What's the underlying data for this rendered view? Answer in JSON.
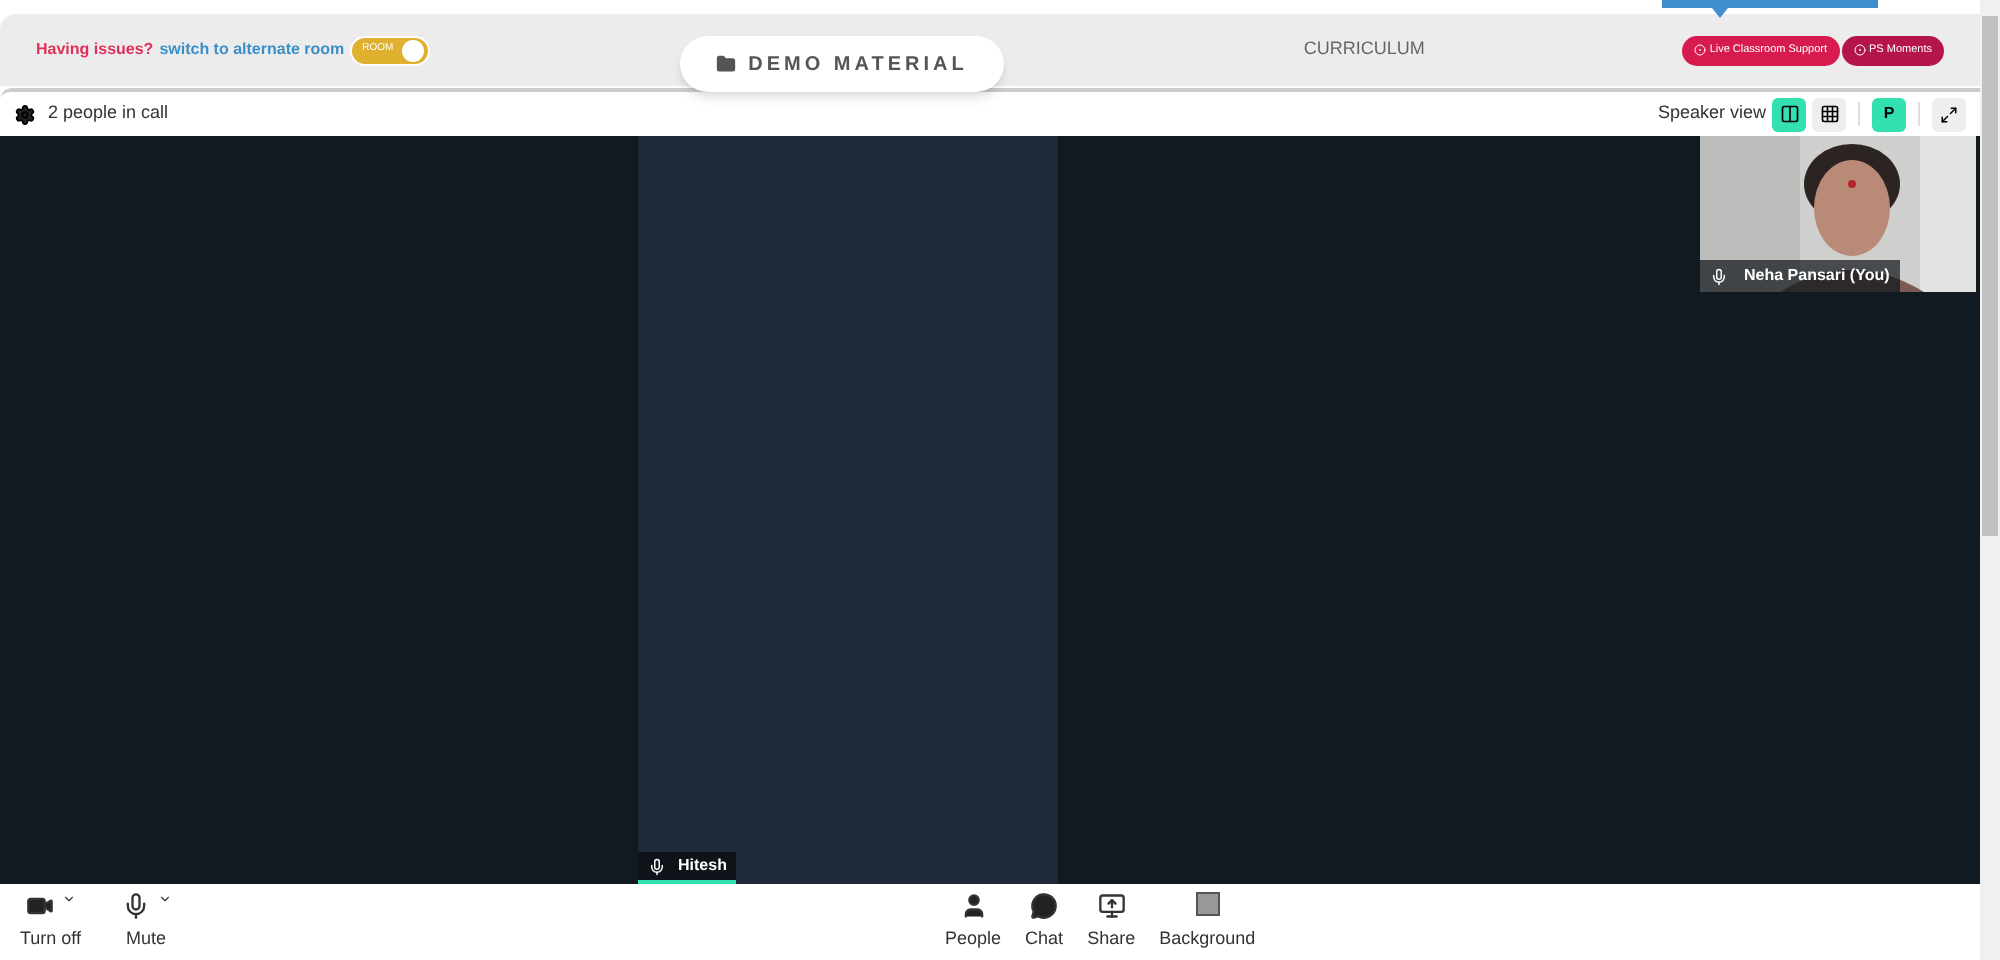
{
  "header": {
    "issue_text": "Having issues?",
    "switch_link": "switch to alternate room",
    "room_toggle": {
      "label": "ROOM",
      "on": true
    },
    "demo_button": "DEMO MATERIAL",
    "curriculum": "CURRICULUM",
    "support_buttons": [
      "Live Classroom Support",
      "PS Moments"
    ]
  },
  "call_bar": {
    "people_count": "2 people in call",
    "view_label": "Speaker view",
    "views": [
      {
        "kind": "speaker",
        "selected": true
      },
      {
        "kind": "grid",
        "selected": false
      }
    ],
    "avatar_letter": "P"
  },
  "participants": [
    {
      "name": "Hitesh",
      "kind": "tile"
    },
    {
      "name": "Neha Pansari (You)",
      "kind": "self"
    }
  ],
  "controls": [
    {
      "label": "Turn off",
      "kind": "camera",
      "dropdown": true
    },
    {
      "label": "Mute",
      "kind": "mic",
      "dropdown": true
    },
    {
      "label": "People",
      "kind": "people",
      "dropdown": false
    },
    {
      "label": "Chat",
      "kind": "chat",
      "dropdown": false
    },
    {
      "label": "Share",
      "kind": "share",
      "dropdown": false
    },
    {
      "label": "Background",
      "kind": "background",
      "dropdown": false
    }
  ]
}
